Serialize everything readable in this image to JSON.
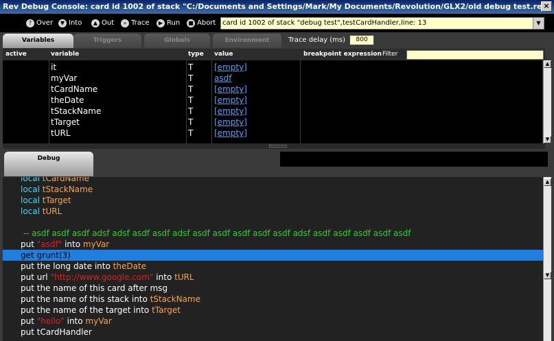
{
  "window": {
    "title": "Rev Debug Console: card id 1002 of stack \"C:/Documents and Settings/Mark/My Documents/Revolution/GLX2/old debug test.rev\"",
    "close_glyph": "×"
  },
  "toolbar": {
    "buttons": [
      {
        "label": "Over",
        "icon": "?"
      },
      {
        "label": "Into",
        "icon": "▼"
      },
      {
        "label": "Out",
        "icon": "▲"
      },
      {
        "label": "Trace",
        "icon": "»"
      },
      {
        "label": "Run",
        "icon": "▶"
      },
      {
        "label": "Abort",
        "icon": "■"
      }
    ],
    "context_value": "card id 1002 of stack \"debug test\",testCardHandler,line: 13",
    "context_arrow": "▼"
  },
  "tabs": [
    {
      "label": "Variables",
      "active": true
    },
    {
      "label": "Triggers",
      "active": false
    },
    {
      "label": "Globals",
      "active": false
    },
    {
      "label": "Environment",
      "active": false
    }
  ],
  "trace": {
    "label": "Trace delay (ms)",
    "value": "800"
  },
  "variables": {
    "headers": {
      "active": "active",
      "variable": "variable",
      "type": "type",
      "value": "value",
      "breakpoint": "breakpoint expression",
      "filter": "Filter"
    },
    "rows": [
      {
        "name": "it",
        "type": "T",
        "value": "[empty]"
      },
      {
        "name": "myVar",
        "type": "T",
        "value": "asdf"
      },
      {
        "name": "tCardName",
        "type": "T",
        "value": "[empty]"
      },
      {
        "name": "theDate",
        "type": "T",
        "value": "[empty]"
      },
      {
        "name": "tStackName",
        "type": "T",
        "value": "[empty]"
      },
      {
        "name": "tTarget",
        "type": "T",
        "value": "[empty]"
      },
      {
        "name": "tURL",
        "type": "T",
        "value": "[empty]"
      }
    ]
  },
  "debug": {
    "tab_label": "Debug"
  },
  "code_lines": [
    [
      {
        "t": "local ",
        "c": "kw"
      },
      {
        "t": "tCardName",
        "c": "var"
      }
    ],
    [
      {
        "t": "local ",
        "c": "kw"
      },
      {
        "t": "tStackName",
        "c": "var"
      }
    ],
    [
      {
        "t": "local ",
        "c": "kw"
      },
      {
        "t": "tTarget",
        "c": "var"
      }
    ],
    [
      {
        "t": "local ",
        "c": "kw"
      },
      {
        "t": "tURL",
        "c": "var"
      }
    ],
    [],
    [
      {
        "t": " -- asdf asdf asdf adsf adsf asdf asdf adsf asdf asdf asdf asdf asdf adsf asdf asdf asdf asdf asdf",
        "c": "cm"
      }
    ],
    [
      {
        "t": "put ",
        "c": "k"
      },
      {
        "t": "\"asdf\"",
        "c": "str"
      },
      {
        "t": " into ",
        "c": "k"
      },
      {
        "t": "myVar",
        "c": "var"
      }
    ],
    [
      {
        "t": "get grunt(3)",
        "c": "k"
      }
    ],
    [
      {
        "t": "put the long date into ",
        "c": "k"
      },
      {
        "t": "theDate",
        "c": "var"
      }
    ],
    [
      {
        "t": "put url ",
        "c": "k"
      },
      {
        "t": "\"http://www.google.com\"",
        "c": "str"
      },
      {
        "t": " into ",
        "c": "k"
      },
      {
        "t": "tURL",
        "c": "var"
      }
    ],
    [
      {
        "t": "put the name of this card after msg",
        "c": "k"
      }
    ],
    [
      {
        "t": "put the name of this stack into ",
        "c": "k"
      },
      {
        "t": "tStackName",
        "c": "var"
      }
    ],
    [
      {
        "t": "put the name of the target into ",
        "c": "k"
      },
      {
        "t": "tTarget",
        "c": "var"
      }
    ],
    [
      {
        "t": "put ",
        "c": "k"
      },
      {
        "t": "\"hello\"",
        "c": "str"
      },
      {
        "t": " into ",
        "c": "k"
      },
      {
        "t": "myVar",
        "c": "var"
      }
    ],
    [
      {
        "t": "put tCardHandler",
        "c": "k"
      }
    ]
  ],
  "highlighted_line": 7,
  "scroll_up": "▲",
  "scroll_down": "▼"
}
